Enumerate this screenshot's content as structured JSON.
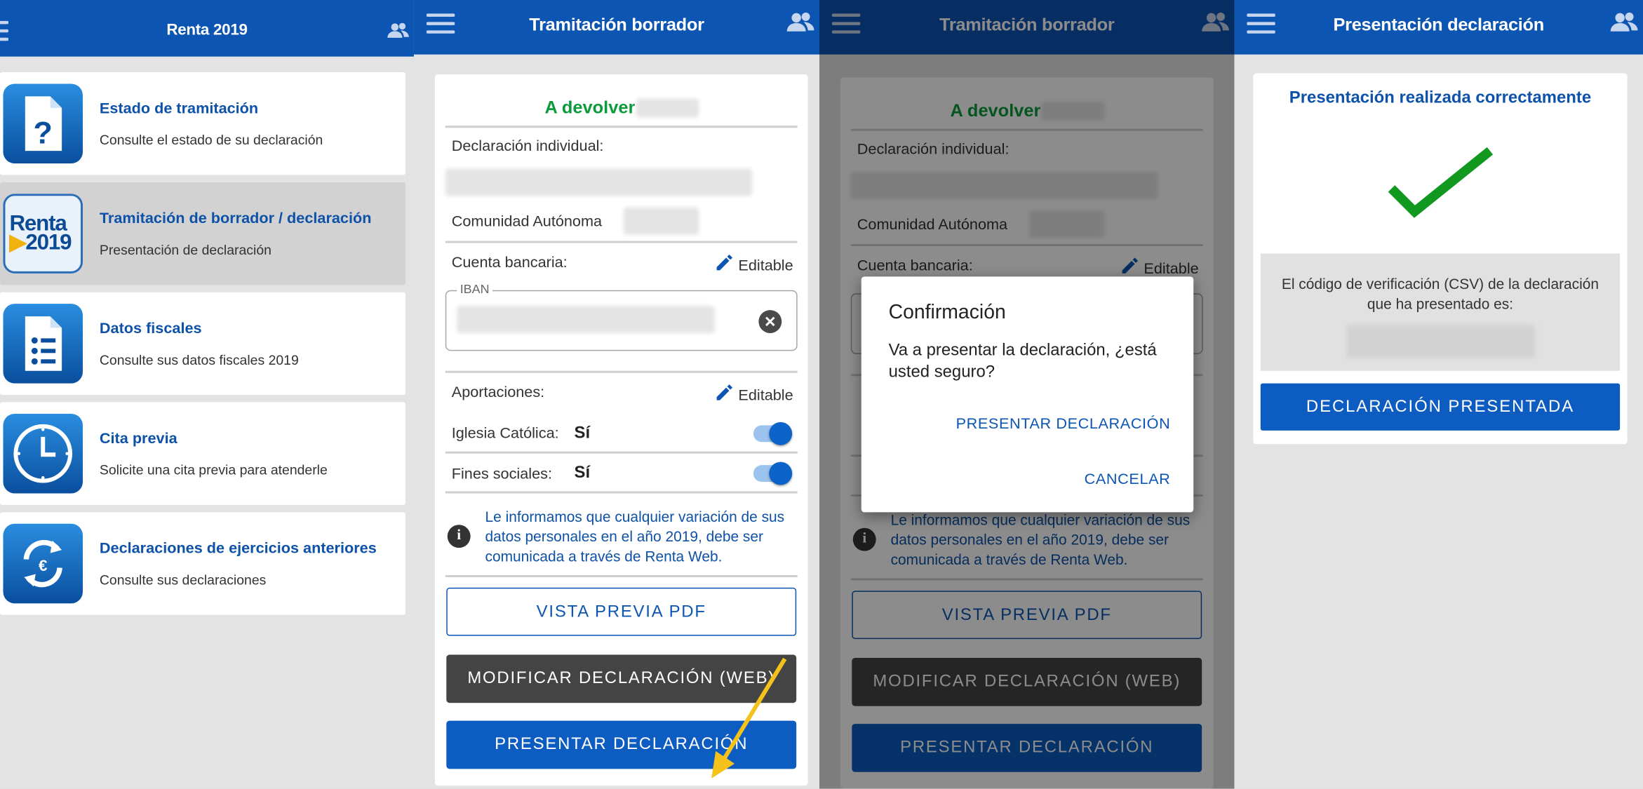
{
  "colors": {
    "brand": "#0c55b2",
    "refund": "#0c9b3a",
    "arrow": "#f5c21b",
    "check": "#11981f"
  },
  "panel1": {
    "title": "Renta 2019",
    "items": [
      {
        "title": "Estado de tramitación",
        "subtitle": "Consulte el estado de su declaración",
        "icon": "question-document-icon"
      },
      {
        "title": "Tramitación de borrador / declaración",
        "subtitle": "Presentación de declaración",
        "icon": "renta-2019-logo",
        "logo_text_1": "Renta",
        "logo_text_2": "2019"
      },
      {
        "title": "Datos fiscales",
        "subtitle": "Consulte sus datos fiscales 2019",
        "icon": "list-document-icon"
      },
      {
        "title": "Cita previa",
        "subtitle": "Solicite una cita previa para atenderle",
        "icon": "clock-icon"
      },
      {
        "title": "Declaraciones de ejercicios anteriores",
        "subtitle": "Consulte sus declaraciones",
        "icon": "euro-refresh-icon"
      }
    ]
  },
  "draft": {
    "title": "Tramitación borrador",
    "refund_label": "A devolver",
    "declaration_label": "Declaración individual:",
    "community_label": "Comunidad Autónoma",
    "bank_label": "Cuenta bancaria:",
    "editable_label": "Editable",
    "iban_label": "IBAN",
    "contributions_label": "Aportaciones:",
    "church_label": "Iglesia Católica:",
    "church_value": "Sí",
    "social_label": "Fines sociales:",
    "social_value": "Sí",
    "info_text": "Le informamos que cualquier variación de sus datos personales en el año 2019, debe ser comunicada a través de Renta Web.",
    "pdf_button": "VISTA PREVIA PDF",
    "modify_button": "MODIFICAR DECLARACIÓN (WEB)",
    "submit_button": "PRESENTAR DECLARACIÓN"
  },
  "dialog": {
    "title": "Confirmación",
    "message": "Va a presentar la declaración, ¿está usted seguro?",
    "confirm": "PRESENTAR DECLARACIÓN",
    "cancel": "CANCELAR"
  },
  "presented": {
    "title": "Presentación declaración",
    "success": "Presentación realizada correctamente",
    "csv_text": "El código de verificación (CSV) de la declaración que ha presentado es:",
    "button": "DECLARACIÓN PRESENTADA"
  }
}
